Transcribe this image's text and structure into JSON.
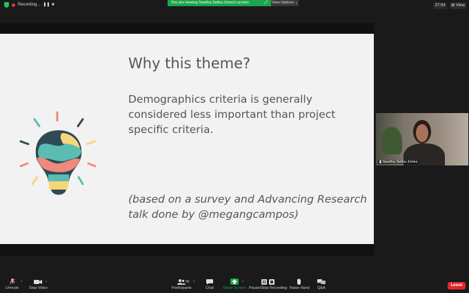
{
  "topbar": {
    "recording_label": "Recording...",
    "banner_text": "You are viewing Swetha Sethu-Jones's screen",
    "view_options_label": "View Options",
    "timer": "37:04",
    "view_label": "View"
  },
  "slide": {
    "title": "Why this theme?",
    "body": "Demographics criteria is generally considered less important than project specific criteria.",
    "note": "(based on a survey and Advancing Research talk done by @megangcampos)"
  },
  "video": {
    "participant_name": "Swetha Sethu-Jones"
  },
  "toolbar": {
    "unmute_label": "Unmute",
    "stop_video_label": "Stop Video",
    "participants_label": "Participants",
    "participants_count": "90",
    "chat_label": "Chat",
    "share_screen_label": "Share Screen",
    "pause_stop_recording_label": "Pause/Stop Recording",
    "raise_hand_label": "Raise Hand",
    "qa_label": "Q&A",
    "leave_label": "Leave"
  },
  "colors": {
    "accent_green": "#1ea54a",
    "leave_red": "#e02828",
    "recording_red": "#e53935"
  }
}
